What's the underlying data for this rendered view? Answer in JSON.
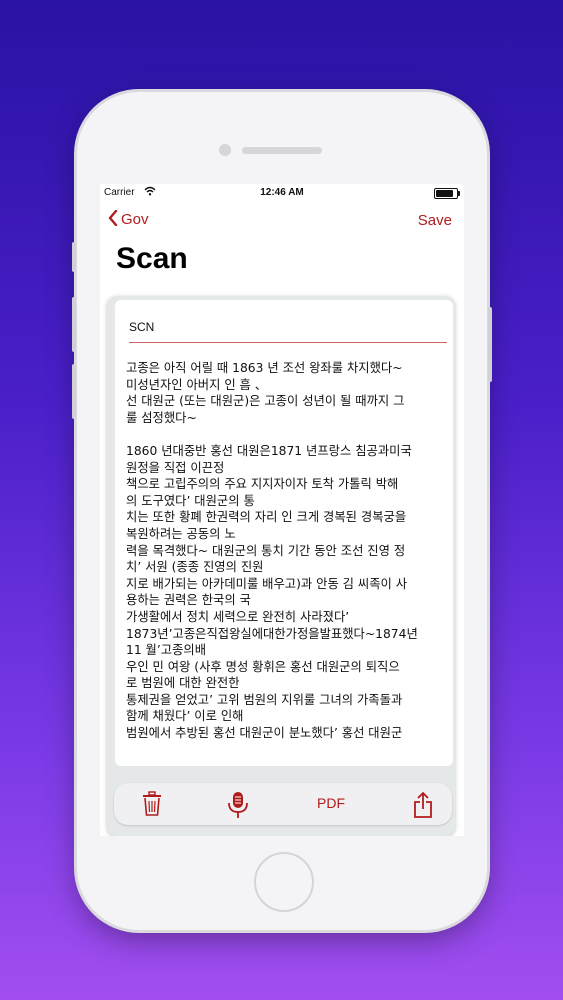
{
  "status_bar": {
    "carrier": "Carrier",
    "time": "12:46 AM"
  },
  "nav": {
    "back_label": "Gov",
    "save_label": "Save",
    "title": "Scan"
  },
  "document": {
    "title": "SCN",
    "body": "고종은 아직 어릴 때 1863 년 조선 왕좌룰 차지했다~\n미성년자인 아버지 인 흠 、\n선 대원군 (또는 대원군)은 고종이 성년이 될 때까지 그\n룰 섬정했다~\n\n1860 년대중반 홍선 대원은1871 년프랑스 침공과미국\n원정을 직접 이끈정\n책으로 고립주의의 주요 지지자이자 토착 가톨릭 박해\n의 도구였다’ 대원군의 통\n치는 또한 황폐 한권력의 자리 인 크게 경복된 경복궁을\n복원하려는 공동의 노\n력을 목격했다~ 대원군의 통치 기간 동안 조선 진영 정\n치’ 서원 (종종 진영의 진원\n지로 배가되는 아카데미룰 배우고)과 안동 김 씨족이 사\n용하는 권력은 한국의 국\n가생활에서 정치 세력으로 완전히 사라졌다’\n1873년’고종은직접왕실에대한가정을발표했다~1874년\n11 월’고종의배\n우인 민 여왕 (사후 명성 황휘은 홍선 대원군의 퇴직으\n로 범원에 대한 완전한\n통제권을 얻었고’ 고위 범원의 지위룰 그녀의 가족돌과\n함께 채웠다’ 이로 인해\n범원에서 추방된 홍선 대원군이 분노했다’ 홍선 대원군"
  },
  "toolbar": {
    "pdf_label": "PDF"
  },
  "colors": {
    "accent": "#b01c1c",
    "background_top": "#2a12a3",
    "background_bottom": "#a24ef0"
  },
  "icons": [
    "chevron-left-icon",
    "wifi-icon",
    "battery-icon",
    "trash-icon",
    "microphone-icon",
    "share-icon"
  ]
}
